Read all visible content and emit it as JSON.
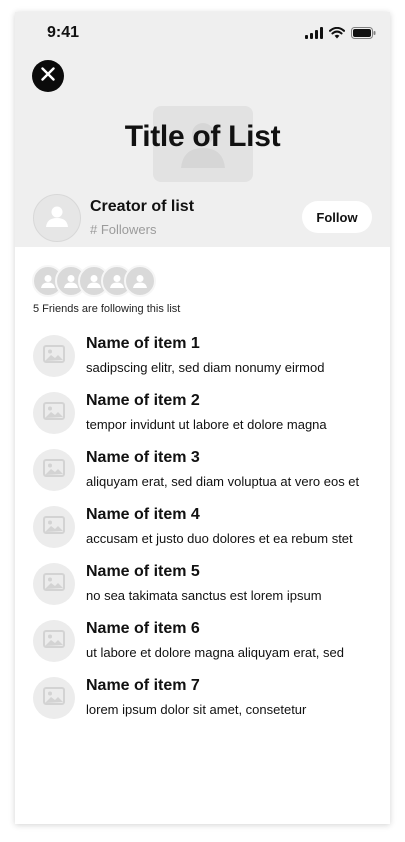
{
  "status": {
    "time": "9:41",
    "icons": [
      "signal-icon",
      "wifi-icon",
      "battery-icon"
    ]
  },
  "header": {
    "close_icon": "close-icon",
    "title": "Title of List",
    "background_color": "#efefef"
  },
  "creator": {
    "name": "Creator of list",
    "followers": "# Followers",
    "follow_label": "Follow"
  },
  "friends": {
    "count_text": "5 Friends are following this list",
    "avatars": 5
  },
  "items": [
    {
      "name": "Name of item 1",
      "desc": "sadipscing elitr, sed diam nonumy eirmod"
    },
    {
      "name": "Name of item 2",
      "desc": "tempor invidunt ut labore et dolore magna"
    },
    {
      "name": "Name of item 3",
      "desc": "aliquyam erat, sed diam voluptua at vero eos et"
    },
    {
      "name": "Name of item 4",
      "desc": "accusam et justo duo dolores et ea rebum stet"
    },
    {
      "name": "Name of item 5",
      "desc": "no sea takimata sanctus est lorem ipsum"
    },
    {
      "name": "Name of item 6",
      "desc": "ut labore et dolore magna aliquyam erat, sed"
    },
    {
      "name": "Name of item 7",
      "desc": "lorem ipsum dolor sit amet, consetetur"
    }
  ]
}
